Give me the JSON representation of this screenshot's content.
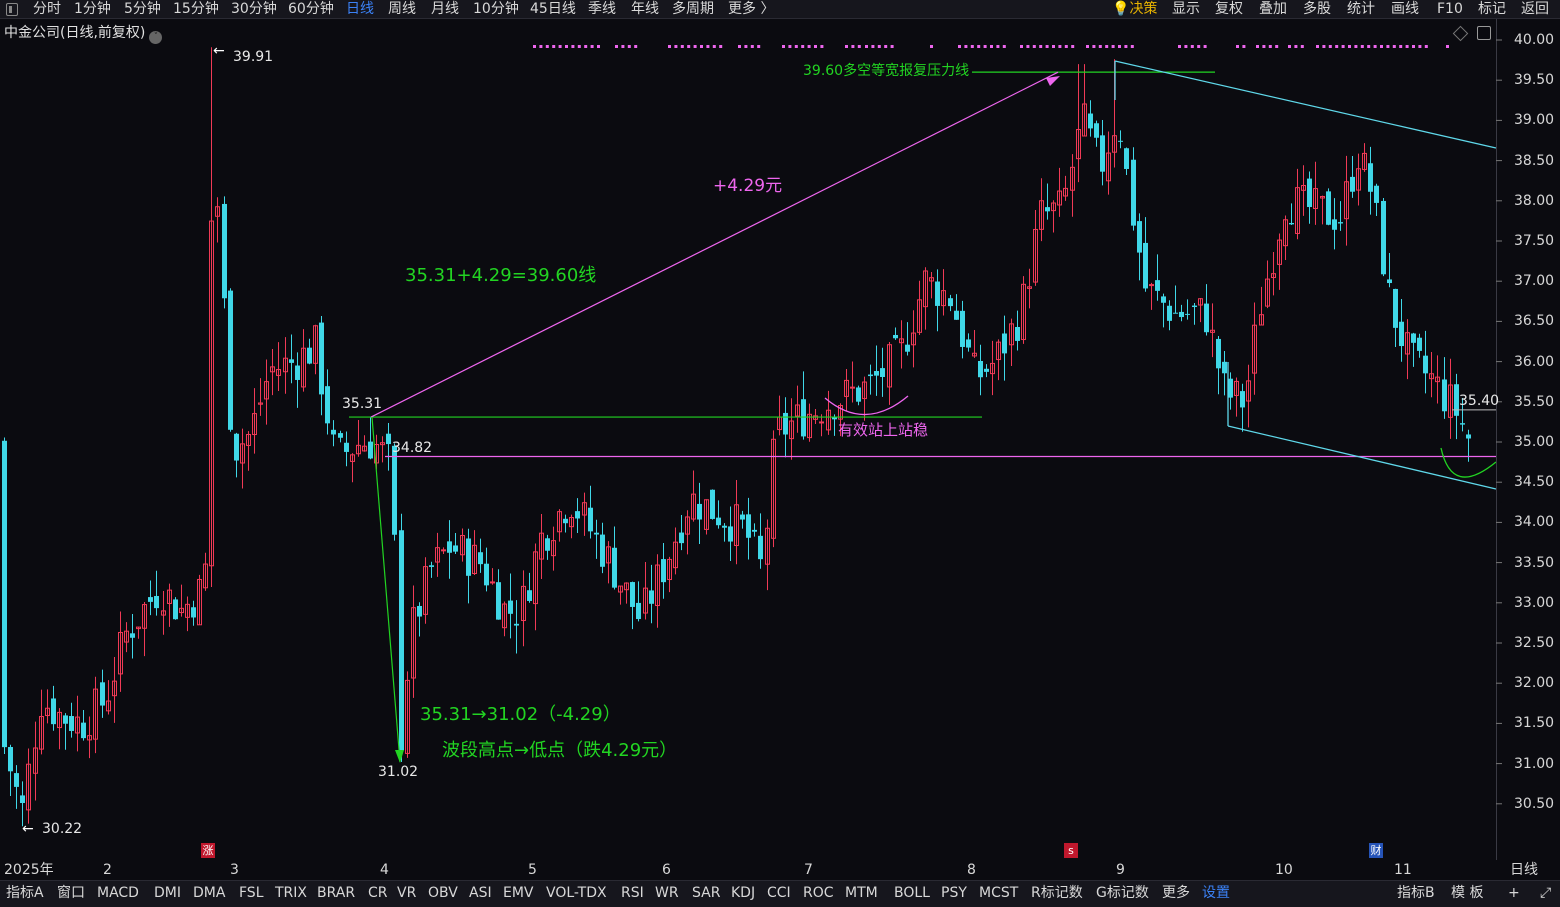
{
  "topbar": {
    "periods": [
      "分时",
      "1分钟",
      "5分钟",
      "15分钟",
      "30分钟",
      "60分钟",
      "日线",
      "周线",
      "月线",
      "10分钟",
      "45日线",
      "季线",
      "年线",
      "多周期",
      "更多 〉"
    ],
    "active_period": "日线",
    "right_menu": [
      "决策",
      "显示",
      "复权",
      "叠加",
      "多股",
      "统计",
      "画线",
      "F10",
      "标记",
      "返回"
    ]
  },
  "stock_title": "中金公司(日线,前复权)",
  "y_axis": {
    "labels": [
      "40.00",
      "39.50",
      "39.00",
      "38.50",
      "38.00",
      "37.50",
      "37.00",
      "36.50",
      "36.00",
      "35.50",
      "35.00",
      "34.50",
      "34.00",
      "33.50",
      "33.00",
      "32.50",
      "32.00",
      "31.50",
      "31.00",
      "30.50"
    ]
  },
  "x_axis": {
    "labels": [
      "2025年",
      "2",
      "3",
      "4",
      "5",
      "6",
      "7",
      "8",
      "9",
      "10",
      "11"
    ],
    "period_label": "日线"
  },
  "price_labels": {
    "high": "39.91",
    "low": "30.22",
    "peak_a": "35.31",
    "support": "34.82",
    "trough": "31.02",
    "last": "35.40"
  },
  "annotations": {
    "resistance_line": "39.60多空等宽报复压力线",
    "rise": "+4.29元",
    "formula": "35.31+4.29=39.60线",
    "drop_formula": "35.31→31.02（-4.29）",
    "drop_desc": "波段高点→低点（跌4.29元）",
    "stand_firm": "有效站上站稳"
  },
  "badges": {
    "zhang": "涨",
    "s": "s",
    "cai": "财"
  },
  "bottombar": {
    "indicators": [
      "指标A",
      "窗口",
      "MACD",
      "DMI",
      "DMA",
      "FSL",
      "TRIX",
      "BRAR",
      "CR",
      "VR",
      "OBV",
      "ASI",
      "EMV",
      "VOL-TDX",
      "RSI",
      "WR",
      "SAR",
      "KDJ",
      "CCI",
      "ROC",
      "MTM",
      "BOLL",
      "PSY",
      "MCST",
      "R标记数",
      "G标记数",
      "更多",
      "设置"
    ],
    "active": "设置",
    "right": [
      "指标B",
      "模 板",
      "+"
    ]
  },
  "colors": {
    "up": "#f03a56",
    "down": "#40d8e8",
    "accent": "#3b82f6",
    "green": "#22d422",
    "magenta": "#ee66ee",
    "cyan": "#5fd8ea"
  },
  "chart_data": {
    "type": "candlestick",
    "title": "中金公司(日线,前复权)",
    "ylim": [
      30.1,
      40.1
    ],
    "key_levels": {
      "high": 39.91,
      "low": 30.22,
      "resistance": 39.6,
      "peak": 35.31,
      "support": 34.82,
      "trough": 31.02,
      "last": 35.4
    },
    "trendlines": [
      {
        "name": "rise",
        "from": {
          "x": 4,
          "y": 35.31
        },
        "to": {
          "x": 8.65,
          "y": 39.6
        }
      },
      {
        "name": "drop",
        "from": {
          "x": 3.98,
          "y": 35.31
        },
        "to": {
          "x": 4.15,
          "y": 31.02
        }
      }
    ]
  }
}
